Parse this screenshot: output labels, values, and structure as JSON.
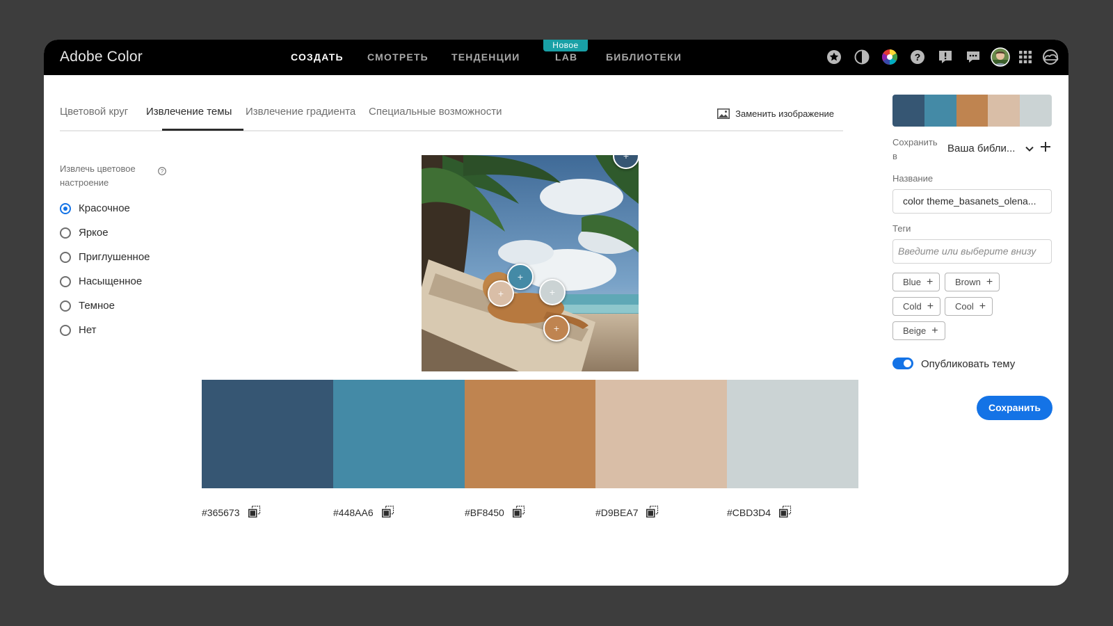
{
  "header": {
    "brand": "Adobe Color",
    "nav": [
      {
        "label": "СОЗДАТЬ",
        "active": true
      },
      {
        "label": "СМОТРЕТЬ",
        "active": false
      },
      {
        "label": "ТЕНДЕНЦИИ",
        "active": false
      },
      {
        "label": "LAB",
        "active": false
      },
      {
        "label": "БИБЛИОТЕКИ",
        "active": false
      }
    ],
    "new_badge": "Новое",
    "icons": [
      "star-icon",
      "contrast-icon",
      "color-wheel-icon",
      "help-icon",
      "feedback-icon",
      "chat-icon",
      "avatar",
      "apps-grid-icon",
      "creative-cloud-icon"
    ]
  },
  "tabs": [
    {
      "label": "Цветовой круг",
      "active": false
    },
    {
      "label": "Извлечение темы",
      "active": true
    },
    {
      "label": "Извлечение градиента",
      "active": false
    },
    {
      "label": "Специальные возможности",
      "active": false
    }
  ],
  "replace_image_label": "Заменить изображение",
  "mood": {
    "label": "Извлечь цветовое настроение",
    "options": [
      {
        "label": "Красочное",
        "checked": true
      },
      {
        "label": "Яркое",
        "checked": false
      },
      {
        "label": "Приглушенное",
        "checked": false
      },
      {
        "label": "Насыщенное",
        "checked": false
      },
      {
        "label": "Темное",
        "checked": false
      },
      {
        "label": "Нет",
        "checked": false
      }
    ]
  },
  "theme": {
    "colors": [
      "#365673",
      "#448AA6",
      "#BF8450",
      "#D9BEA7",
      "#CBD3D4"
    ],
    "hex_labels": [
      "#365673",
      "#448AA6",
      "#BF8450",
      "#D9BEA7",
      "#CBD3D4"
    ]
  },
  "panel": {
    "save_to_label": "Сохранить в",
    "library_value": "Ваша библи...",
    "name_label": "Название",
    "name_value": "color theme_basanets_olena...",
    "tags_label": "Теги",
    "tags_placeholder": "Введите или выберите внизу",
    "suggested_tags": [
      "Blue",
      "Brown",
      "Cold",
      "Cool",
      "Beige"
    ],
    "publish_label": "Опубликовать тему",
    "publish_on": true,
    "save_button": "Сохранить"
  }
}
